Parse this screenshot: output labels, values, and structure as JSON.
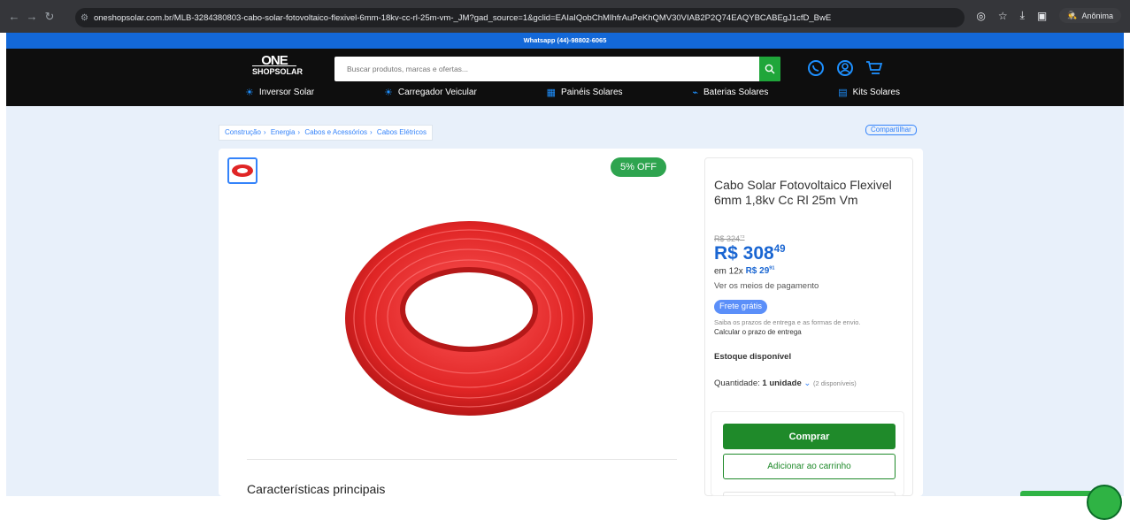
{
  "browser": {
    "url": "oneshopsolar.com.br/MLB-3284380803-cabo-solar-fotovoltaico-flexivel-6mm-18kv-cc-rl-25m-vm-_JM?gad_source=1&gclid=EAIaIQobChMIhfrAuPeKhQMV30VIAB2P2Q74EAQYBCABEgJ1cfD_BwE",
    "incognito_label": "Anônima"
  },
  "site": {
    "topbar_text": "Whatsapp (44)-98802-6065",
    "logo_one": "ONE",
    "logo_shop": "SHOPSOLAR",
    "search_placeholder": "Buscar produtos, marcas e ofertas...",
    "menu": [
      {
        "label": "Inversor Solar",
        "icon": "sun-icon"
      },
      {
        "label": "Carregador Veicular",
        "icon": "sun-icon"
      },
      {
        "label": "Painéis Solares",
        "icon": "solar-panel-icon"
      },
      {
        "label": "Baterias Solares",
        "icon": "battery-icon"
      },
      {
        "label": "Kits Solares",
        "icon": "kit-icon"
      }
    ]
  },
  "breadcrumb": [
    "Construção",
    "Energia",
    "Cabos e Acessórios",
    "Cabos Elétricos"
  ],
  "share_label": "Compartilhar",
  "product": {
    "discount_badge": "5% OFF",
    "title": "Cabo Solar Fotovoltaico Flexivel 6mm 1,8kv Cc Rl 25m Vm",
    "old_price_int": "R$ 324",
    "old_price_cents": "73",
    "price_int": "R$ 308",
    "price_cents": "49",
    "installments_prefix": "em 12x",
    "installment_int": "R$ 29",
    "installment_cents": "91",
    "payment_link": "Ver os meios de pagamento",
    "shipping_badge": "Frete grátis",
    "shipping_info": "Saiba os prazos de entrega e as formas de envio.",
    "calc_link": "Calcular o prazo de entrega",
    "stock": "Estoque disponível",
    "qty_label": "Quantidade:",
    "qty_value": "1 unidade",
    "qty_available": "(2 disponíveis)",
    "buy_label": "Comprar",
    "cart_label": "Adicionar ao carrinho",
    "features_heading": "Características principais",
    "colors": {
      "accent": "#3483fa",
      "buy": "#1f8a2a",
      "cable": "#e02525"
    }
  }
}
